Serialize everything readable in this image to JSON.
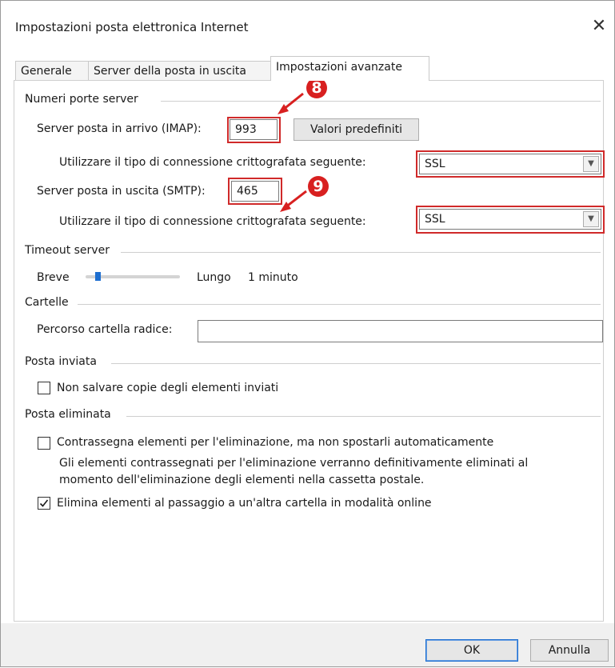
{
  "window": {
    "title": "Impostazioni posta elettronica Internet",
    "close_glyph": "✕"
  },
  "tabs": [
    {
      "label": "Generale",
      "active": false
    },
    {
      "label": "Server della posta in uscita",
      "active": false
    },
    {
      "label": "Impostazioni avanzate",
      "active": true
    }
  ],
  "sections": {
    "ports": {
      "legend": "Numeri porte server",
      "incoming_label": "Server posta in arrivo (IMAP):",
      "incoming_value": "993",
      "defaults_button": "Valori predefiniti",
      "incoming_enc_label": "Utilizzare il tipo di connessione crittografata seguente:",
      "incoming_enc_value": "SSL",
      "outgoing_label": "Server posta in uscita (SMTP):",
      "outgoing_value": "465",
      "outgoing_enc_label": "Utilizzare il tipo di connessione crittografata seguente:",
      "outgoing_enc_value": "SSL"
    },
    "timeout": {
      "legend": "Timeout server",
      "short_label": "Breve",
      "long_label": "Lungo",
      "value_text": "1 minuto",
      "slider_fraction": 0.05
    },
    "folders": {
      "legend": "Cartelle",
      "root_label": "Percorso cartella radice:",
      "root_value": ""
    },
    "sent": {
      "legend": "Posta inviata",
      "no_copies_label": "Non salvare copie degli elementi inviati",
      "no_copies_checked": false
    },
    "deleted": {
      "legend": "Posta eliminata",
      "mark_label": "Contrassegna elementi per l'eliminazione, ma non spostarli automaticamente",
      "mark_checked": false,
      "mark_note_line1": "Gli elementi contrassegnati per l'eliminazione verranno definitivamente eliminati al",
      "mark_note_line2": "momento dell'eliminazione degli elementi nella cassetta postale.",
      "purge_label": "Elimina elementi al passaggio a un'altra cartella in modalità online",
      "purge_checked": true
    }
  },
  "annotations": {
    "badge_8": "8",
    "badge_9": "9",
    "color": "#d82020"
  },
  "footer": {
    "ok_label": "OK",
    "cancel_label": "Annulla"
  }
}
